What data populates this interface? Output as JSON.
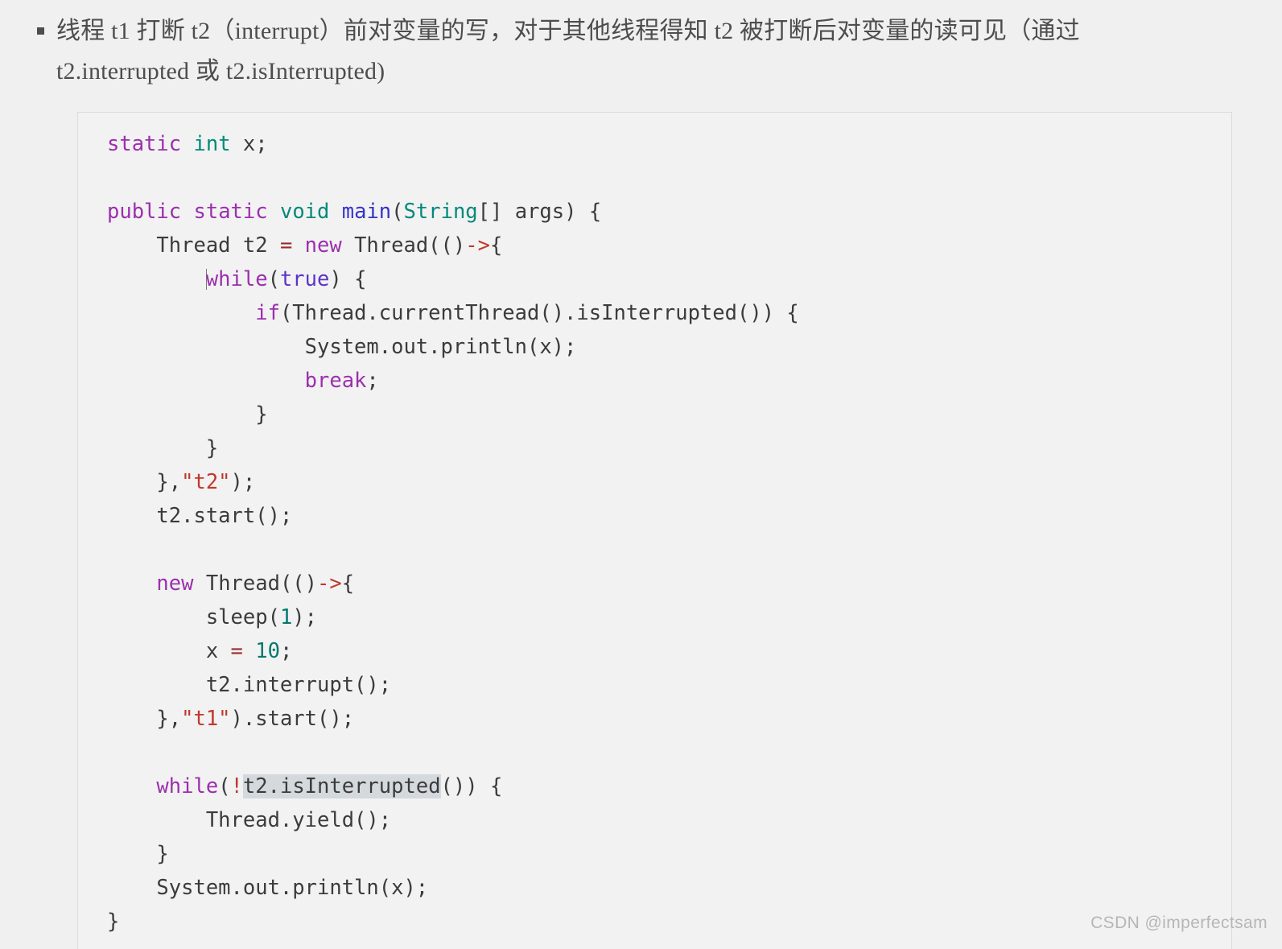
{
  "note": {
    "bullet_marker": "square-bullet",
    "line1": "线程 t1 打断 t2（interrupt）前对变量的写，对于其他线程得知 t2 被打断后对变量的读可见（通过",
    "line2": "t2.interrupted 或 t2.isInterrupted)"
  },
  "code_block": {
    "language": "java",
    "background": "#f2f2f2",
    "border_color": "#dcdcdc",
    "selection_text": "t2.isInterrupted",
    "selection_color": "#d4d9dd",
    "tokens": {
      "keyword_color": "#9b2fae",
      "type_color": "#00897b",
      "method_color": "#3333cc",
      "literal_color": "#5a33cc",
      "number_color": "#00796b",
      "string_color": "#c0392b",
      "operator_color": "#c0392b",
      "plain_color": "#3b3b3b"
    },
    "lines": [
      {
        "n": 1,
        "text": "static int x;"
      },
      {
        "n": 2,
        "text": ""
      },
      {
        "n": 3,
        "text": "public static void main(String[] args) {"
      },
      {
        "n": 4,
        "text": "    Thread t2 = new Thread(()->{"
      },
      {
        "n": 5,
        "text": "        while(true) {"
      },
      {
        "n": 6,
        "text": "            if(Thread.currentThread().isInterrupted()) {"
      },
      {
        "n": 7,
        "text": "                System.out.println(x);"
      },
      {
        "n": 8,
        "text": "                break;"
      },
      {
        "n": 9,
        "text": "            }"
      },
      {
        "n": 10,
        "text": "        }"
      },
      {
        "n": 11,
        "text": "    },\"t2\");"
      },
      {
        "n": 12,
        "text": "    t2.start();"
      },
      {
        "n": 13,
        "text": ""
      },
      {
        "n": 14,
        "text": "    new Thread(()->{"
      },
      {
        "n": 15,
        "text": "        sleep(1);"
      },
      {
        "n": 16,
        "text": "        x = 10;"
      },
      {
        "n": 17,
        "text": "        t2.interrupt();"
      },
      {
        "n": 18,
        "text": "    },\"t1\").start();"
      },
      {
        "n": 19,
        "text": ""
      },
      {
        "n": 20,
        "text": "    while(!t2.isInterrupted()) {"
      },
      {
        "n": 21,
        "text": "        Thread.yield();"
      },
      {
        "n": 22,
        "text": "    }"
      },
      {
        "n": 23,
        "text": "    System.out.println(x);"
      },
      {
        "n": 24,
        "text": "}"
      }
    ]
  },
  "watermark": {
    "text": "CSDN @imperfectsam"
  }
}
